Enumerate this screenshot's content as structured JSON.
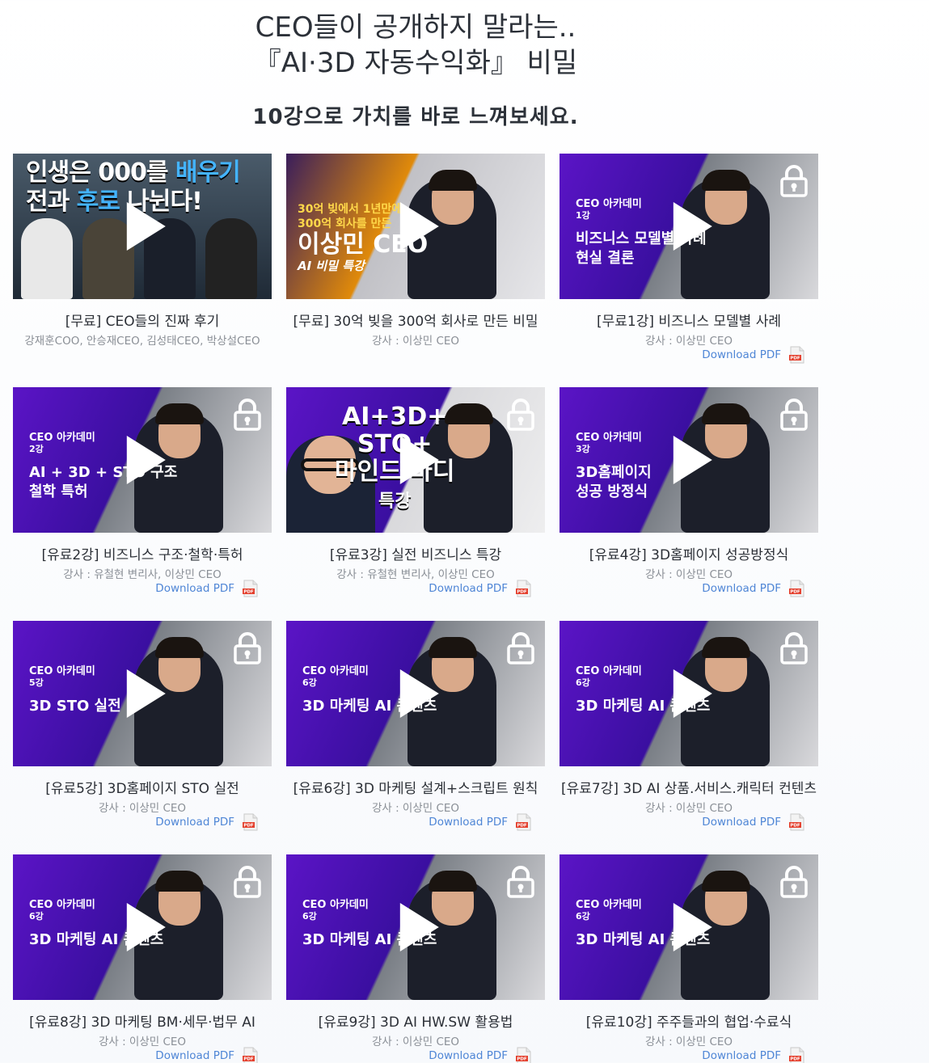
{
  "hero": {
    "line1": "CEO들이 공개하지 말라는..",
    "line2": "『AI·3D 자동수익화』 비밀",
    "subtitle": "10강으로 가치를 바로 느껴보세요."
  },
  "lectures": [
    {
      "title": "[무료] CEO들의 진짜 후기",
      "instructor": "강재훈COO, 안승재CEO, 김성태CEO, 박상설CEO",
      "pdf": null,
      "thumb": "free1",
      "thumb_text": {
        "l1": "인생은 000를 ",
        "hl1": "배우기",
        "l2": "전과 ",
        "hl2": "후로",
        "l3": " 나뉜다!"
      }
    },
    {
      "title": "[무료] 30억 빚을 300억 회사로 만든 비밀",
      "instructor": "강사 : 이상민 CEO",
      "pdf": null,
      "thumb": "free2",
      "thumb_text": {
        "top": "30억 빚에서 1년만에",
        "mid": "300억 회사를 만든",
        "big": "이상민 CEO",
        "sub": "AI 비밀 특강"
      }
    },
    {
      "title": "[무료1강] 비즈니스 모델별 사례",
      "instructor": "강사 : 이상민 CEO",
      "pdf": "Download PDF",
      "thumb": "std",
      "thumb_text": {
        "brand": "CEO 아카데미",
        "num": "1강",
        "l1": "비즈니스 모델별 사례",
        "l2": "현실 결론"
      }
    },
    {
      "title": "[유료2강] 비즈니스 구조·철학·특허",
      "instructor": "강사 : 유철현 변리사, 이상민 CEO",
      "pdf": "Download PDF",
      "thumb": "std",
      "thumb_text": {
        "brand": "CEO 아카데미",
        "num": "2강",
        "l1": "AI + 3D + STO 구조",
        "l2": "철학 특허"
      }
    },
    {
      "title": "[유료3강] 실전 비즈니스 특강",
      "instructor": "강사 : 유철현 변리사, 이상민 CEO",
      "pdf": "Download PDF",
      "thumb": "c3",
      "thumb_text": {
        "l1": "AI+3D+",
        "l2": "STO+",
        "l3": "마인드 바디",
        "l4": "특강"
      }
    },
    {
      "title": "[유료4강] 3D홈페이지 성공방정식",
      "instructor": "강사 : 이상민 CEO",
      "pdf": "Download PDF",
      "thumb": "std",
      "thumb_text": {
        "brand": "CEO 아카데미",
        "num": "3강",
        "l1": "3D홈페이지",
        "l2": "성공 방정식"
      }
    },
    {
      "title": "[유료5강] 3D홈페이지 STO 실전",
      "instructor": "강사 : 이상민 CEO",
      "pdf": "Download PDF",
      "thumb": "std",
      "thumb_text": {
        "brand": "CEO 아카데미",
        "num": "5강",
        "l1": "3D STO 실전",
        "l2": ""
      }
    },
    {
      "title": "[유료6강] 3D 마케팅 설계+스크립트 원칙",
      "instructor": "강사 : 이상민 CEO",
      "pdf": "Download PDF",
      "thumb": "std",
      "thumb_text": {
        "brand": "CEO 아카데미",
        "num": "6강",
        "l1": "3D 마케팅 AI 콘텐츠",
        "l2": ""
      }
    },
    {
      "title": "[유료7강] 3D AI 상품.서비스.캐릭터 컨텐츠",
      "instructor": "강사 : 이상민 CEO",
      "pdf": "Download PDF",
      "thumb": "std",
      "thumb_text": {
        "brand": "CEO 아카데미",
        "num": "6강",
        "l1": "3D 마케팅 AI 콘텐츠",
        "l2": ""
      }
    },
    {
      "title": "[유료8강] 3D 마케팅 BM·세무·법무 AI",
      "instructor": "강사 : 이상민 CEO",
      "pdf": "Download PDF",
      "thumb": "std",
      "thumb_text": {
        "brand": "CEO 아카데미",
        "num": "6강",
        "l1": "3D 마케팅 AI 콘텐츠",
        "l2": ""
      }
    },
    {
      "title": "[유료9강] 3D AI HW.SW 활용법",
      "instructor": "강사 : 이상민 CEO",
      "pdf": "Download PDF",
      "thumb": "std",
      "thumb_text": {
        "brand": "CEO 아카데미",
        "num": "6강",
        "l1": "3D 마케팅 AI 콘텐츠",
        "l2": ""
      }
    },
    {
      "title": "[유료10강] 주주들과의 협업·수료식",
      "instructor": "강사 : 이상민 CEO",
      "pdf": "Download PDF",
      "thumb": "std",
      "thumb_text": {
        "brand": "CEO 아카데미",
        "num": "6강",
        "l1": "3D 마케팅 AI 콘텐츠",
        "l2": ""
      }
    }
  ],
  "locked": [
    false,
    false,
    true,
    true,
    true,
    true,
    true,
    true,
    true,
    true,
    true,
    true
  ],
  "colors": {
    "accent": "#4f86d6",
    "thumb_purple": "#5b14c6",
    "title": "#2b2f36",
    "muted": "#8a8f96"
  },
  "icons": {
    "play": "play-icon",
    "lock": "lock-icon",
    "pdf": "pdf-file-icon"
  }
}
